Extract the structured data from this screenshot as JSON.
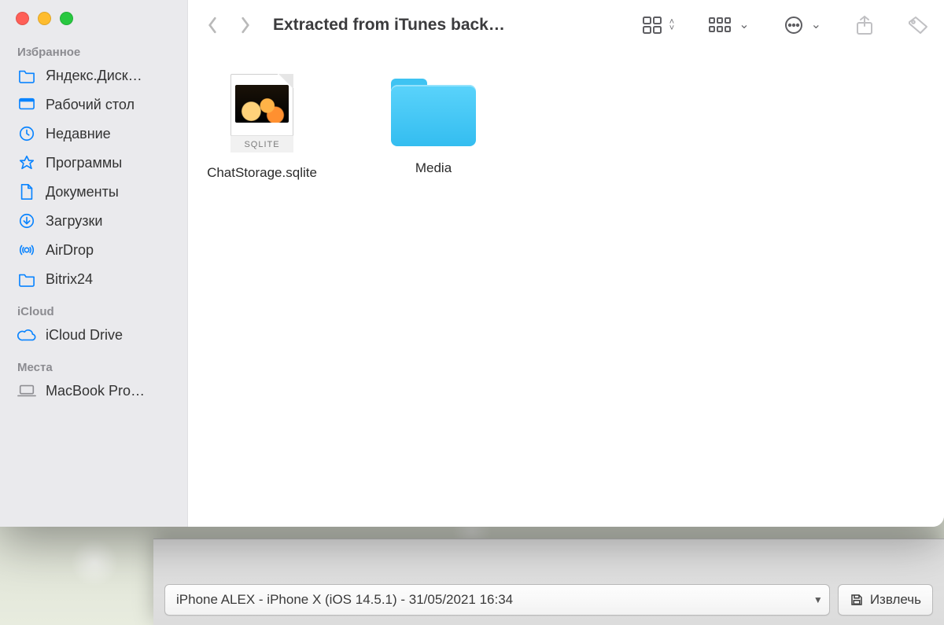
{
  "window": {
    "title": "Extracted from iTunes back…"
  },
  "sidebar": {
    "sections": {
      "favorites": "Избранное",
      "icloud": "iCloud",
      "locations": "Места"
    },
    "favorites": [
      {
        "label": "Яндекс.Диск…",
        "icon": "folder"
      },
      {
        "label": "Рабочий стол",
        "icon": "desktop"
      },
      {
        "label": "Недавние",
        "icon": "clock"
      },
      {
        "label": "Программы",
        "icon": "apps"
      },
      {
        "label": "Документы",
        "icon": "document"
      },
      {
        "label": "Загрузки",
        "icon": "download"
      },
      {
        "label": "AirDrop",
        "icon": "airdrop"
      },
      {
        "label": "Bitrix24",
        "icon": "folder"
      }
    ],
    "icloud": [
      {
        "label": "iCloud Drive",
        "icon": "cloud"
      }
    ],
    "locations": [
      {
        "label": "MacBook Pro…",
        "icon": "laptop"
      }
    ]
  },
  "items": [
    {
      "name": "ChatStorage.sqlite",
      "type": "sqlite",
      "badge": "SQLITE"
    },
    {
      "name": "Media",
      "type": "folder"
    }
  ],
  "lower": {
    "device": "iPhone ALEX - iPhone X (iOS 14.5.1) - 31/05/2021 16:34",
    "extract": "Извлечь"
  }
}
